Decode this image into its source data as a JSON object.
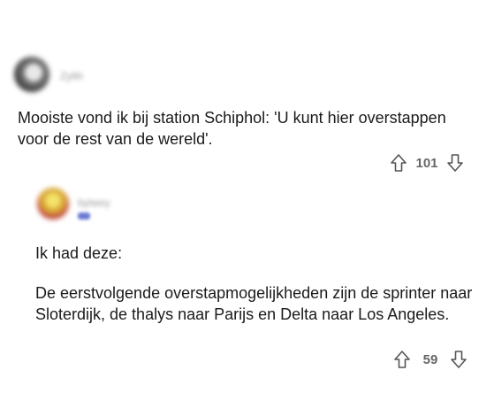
{
  "comments": [
    {
      "username": "Zylth",
      "body": "Mooiste vond ik bij station Schiphol: 'U kunt hier overstappen voor de rest van de wereld'.",
      "score": "101",
      "avatar_color": "#4a4a4a"
    },
    {
      "username": "bylwey",
      "body_line1": "Ik had deze:",
      "body_line2": "De eerstvolgende overstapmogelijkheden zijn de sprinter naar Sloterdijk, de thalys naar Parijs en Delta naar Los Angeles.",
      "score": "59",
      "avatar_color": "#d9a838",
      "flair_color": "#6d7ad6"
    }
  ],
  "icons": {
    "upvote": "arrow-up-outline-icon",
    "downvote": "arrow-down-outline-icon"
  },
  "colors": {
    "text": "#1a1a1b",
    "muted": "#666666",
    "background": "#ffffff"
  }
}
